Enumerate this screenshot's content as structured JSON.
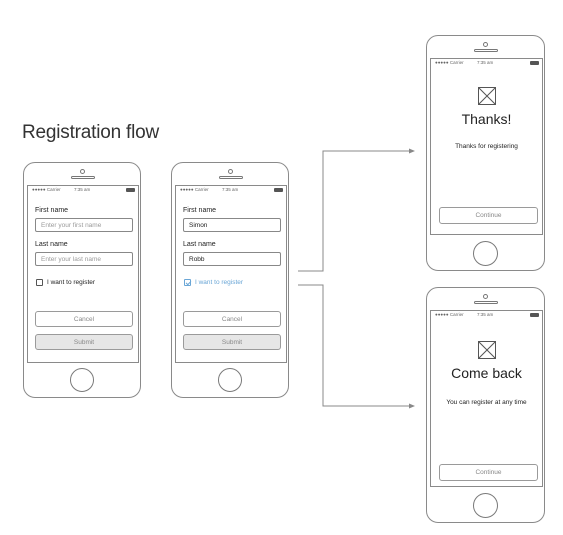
{
  "title": "Registration flow",
  "status": {
    "carrier": "●●●●● Carrier",
    "time": "7:35 am"
  },
  "form_empty": {
    "first_name_label": "First name",
    "first_name_placeholder": "Enter your first name",
    "last_name_label": "Last name",
    "last_name_placeholder": "Enter your last name",
    "checkbox_label": "I want to register",
    "checkbox_checked": false,
    "cancel_label": "Cancel",
    "submit_label": "Submit"
  },
  "form_filled": {
    "first_name_label": "First name",
    "first_name_value": "Simon",
    "last_name_label": "Last name",
    "last_name_value": "Robb",
    "checkbox_label": "I want to register",
    "checkbox_checked": true,
    "cancel_label": "Cancel",
    "submit_label": "Submit"
  },
  "thanks_screen": {
    "heading": "Thanks!",
    "message": "Thanks for registering",
    "continue_label": "Continue"
  },
  "comeback_screen": {
    "heading": "Come back",
    "message": "You can register at any time",
    "continue_label": "Continue"
  },
  "colors": {
    "accent": "#6aa6d6",
    "outline": "#8a8a8a"
  }
}
